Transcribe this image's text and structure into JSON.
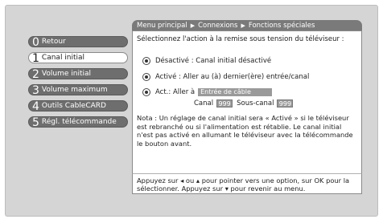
{
  "breadcrumb": {
    "items": [
      "Menu principal",
      "Connexions",
      "Fonctions spéciales"
    ]
  },
  "sidebar": {
    "items": [
      {
        "num": "0",
        "label": "Retour"
      },
      {
        "num": "1",
        "label": "Canal initial"
      },
      {
        "num": "2",
        "label": "Volume initial"
      },
      {
        "num": "3",
        "label": "Volume maximum"
      },
      {
        "num": "4",
        "label": "Outils CableCARD"
      },
      {
        "num": "5",
        "label": "Régl. télécommande"
      }
    ],
    "selected_index": 1
  },
  "panel": {
    "prompt": "Sélectionnez l'action à la remise sous tension du téléviseur :",
    "options": [
      "Désactivé : Canal initial désactivé",
      "Activé : Aller au (à) dernier(ère) entrée/canal",
      "Act.: Aller à"
    ],
    "input_value": "Entrée de câble",
    "channel_label": "Canal",
    "channel_value": "999",
    "subchannel_label": "Sous-canal",
    "subchannel_value": "999",
    "note": "Nota : Un réglage de canal initial sera « Activé » si le téléviseur est rebranché ou si l'alimentation est rétablie. Le canal initial n'est pas activé en allumant le téléviseur avec la télécommande le bouton avant."
  },
  "help": {
    "text_part1": "Appuyez sur",
    "text_part2": "ou",
    "text_part3": "pour pointer vers une option, sur OK pour la sélectionner. Appuyez sur",
    "text_part4": "pour revenir au menu."
  }
}
